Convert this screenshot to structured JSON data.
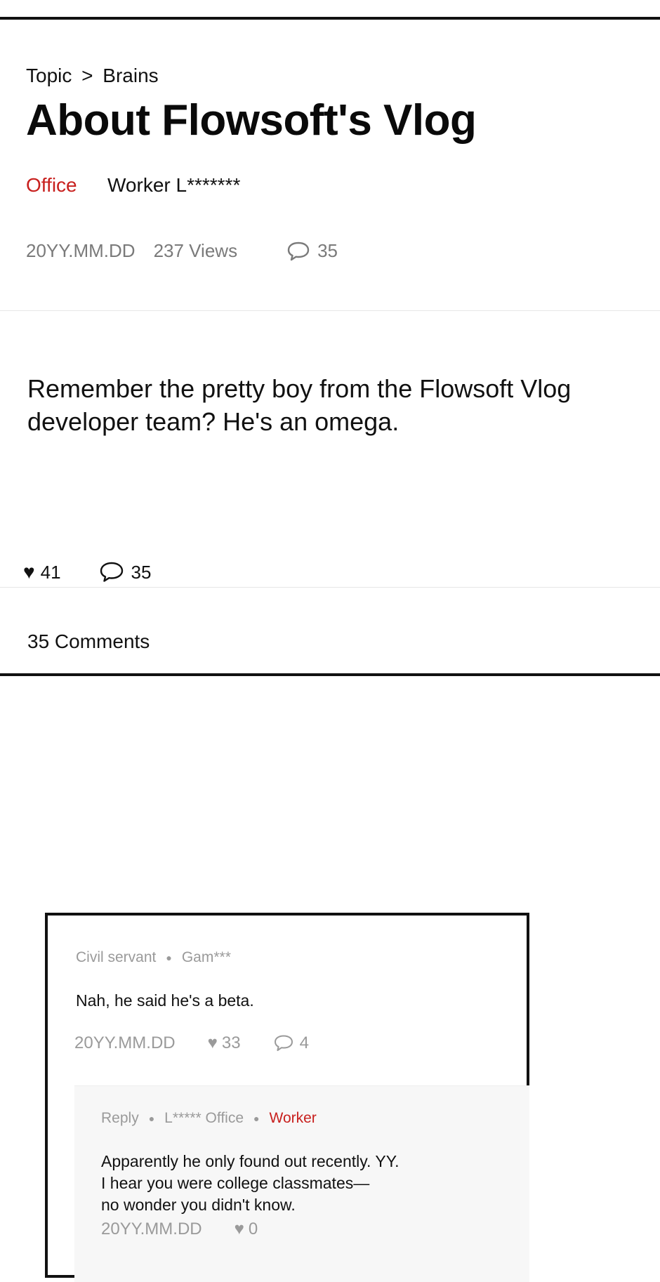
{
  "post": {
    "breadcrumb": {
      "section": "Topic",
      "separator": ">",
      "topic": "Brains"
    },
    "title": "About Flowsoft's Vlog",
    "board": "Office",
    "author": "Worker L*******",
    "date": "20YY.MM.DD",
    "views": "237 Views",
    "comment_count": "35",
    "body": "Remember the pretty boy from the Flowsoft Vlog developer team? He's an omega.",
    "likes": "41",
    "comments_label": "35 Comments"
  },
  "comment": {
    "role": "Civil servant",
    "user": "Gam***",
    "text": "Nah, he said he's a beta.",
    "date": "20YY.MM.DD",
    "likes": "33",
    "replies": "4",
    "reply": {
      "label": "Reply",
      "user": "L***** Office",
      "tag": "Worker",
      "lines": [
        "Apparently he only found out recently. YY.",
        "I hear you were college classmates—",
        "no wonder you didn't know."
      ],
      "date": "20YY.MM.DD",
      "likes": "0"
    }
  },
  "icons": {
    "heart": "heart-icon",
    "comment": "speech-bubble-icon"
  },
  "colors": {
    "accent": "#c8201e",
    "muted": "#7a7a7a",
    "light_muted": "#9a9a9a"
  }
}
